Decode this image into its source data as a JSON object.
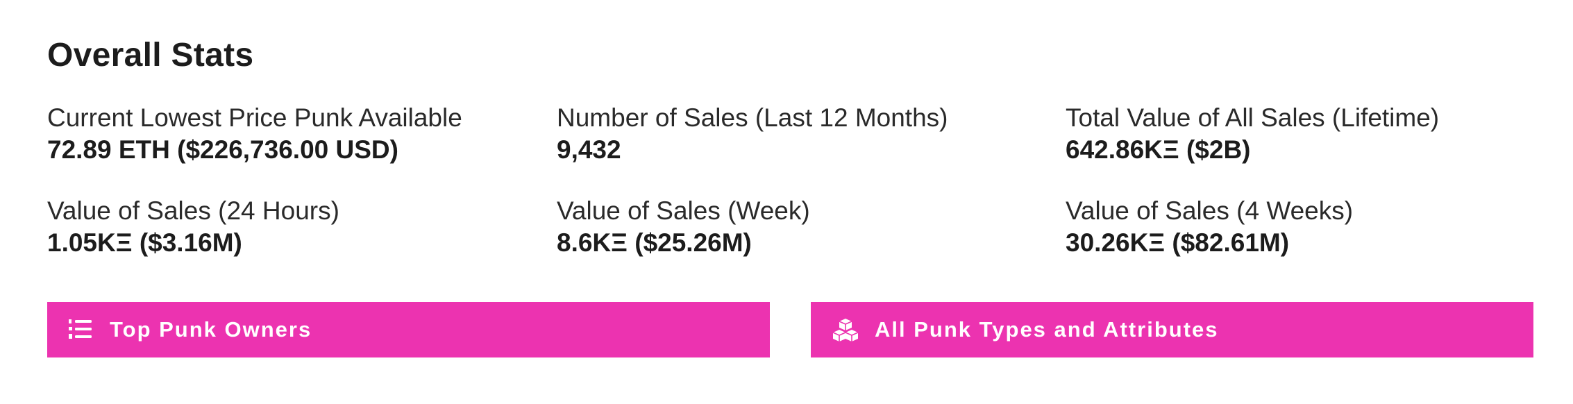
{
  "section": {
    "title": "Overall Stats"
  },
  "stats": [
    {
      "label": "Current Lowest Price Punk Available",
      "value": "72.89 ETH ($226,736.00 USD)"
    },
    {
      "label": "Number of Sales (Last 12 Months)",
      "value": "9,432"
    },
    {
      "label": "Total Value of All Sales (Lifetime)",
      "value": "642.86KΞ ($2B)"
    },
    {
      "label": "Value of Sales (24 Hours)",
      "value": "1.05KΞ ($3.16M)"
    },
    {
      "label": "Value of Sales (Week)",
      "value": "8.6KΞ ($25.26M)"
    },
    {
      "label": "Value of Sales (4 Weeks)",
      "value": "30.26KΞ ($82.61M)"
    }
  ],
  "buttons": {
    "owners": {
      "label": "Top Punk Owners",
      "icon": "list-ol-icon"
    },
    "types": {
      "label": "All Punk Types and Attributes",
      "icon": "cubes-icon"
    }
  },
  "colors": {
    "accent": "#ec33b0",
    "text": "#1c1c1c",
    "button_text": "#ffffff"
  }
}
